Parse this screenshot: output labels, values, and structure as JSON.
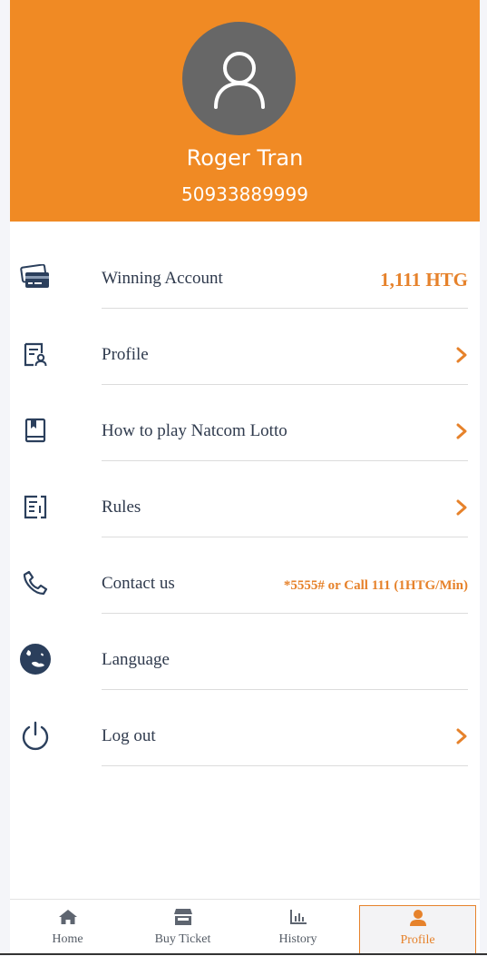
{
  "user": {
    "name": "Roger Tran",
    "phone": "50933889999"
  },
  "menu": {
    "items": [
      {
        "label": "Winning Account",
        "value": "1,111 HTG",
        "icon": "credit-cards-icon"
      },
      {
        "label": "Profile",
        "icon": "profile-card-icon"
      },
      {
        "label": "How to play Natcom Lotto",
        "icon": "book-icon"
      },
      {
        "label": "Rules",
        "icon": "rules-document-icon"
      },
      {
        "label": "Contact us",
        "value": "*5555# or Call 111 (1HTG/Min)",
        "icon": "phone-icon"
      },
      {
        "label": "Language",
        "icon": "globe-icon"
      },
      {
        "label": "Log out",
        "icon": "power-icon"
      }
    ]
  },
  "tabbar": {
    "tabs": [
      {
        "label": "Home",
        "icon": "home-icon"
      },
      {
        "label": "Buy Ticket",
        "icon": "store-icon"
      },
      {
        "label": "History",
        "icon": "bar-chart-icon"
      },
      {
        "label": "Profile",
        "icon": "user-icon",
        "active": true
      }
    ]
  },
  "colors": {
    "accent": "#f08a24",
    "accent_text": "#e6822b",
    "icon_navy": "#2b3f5c",
    "avatar_gray": "#676767"
  }
}
